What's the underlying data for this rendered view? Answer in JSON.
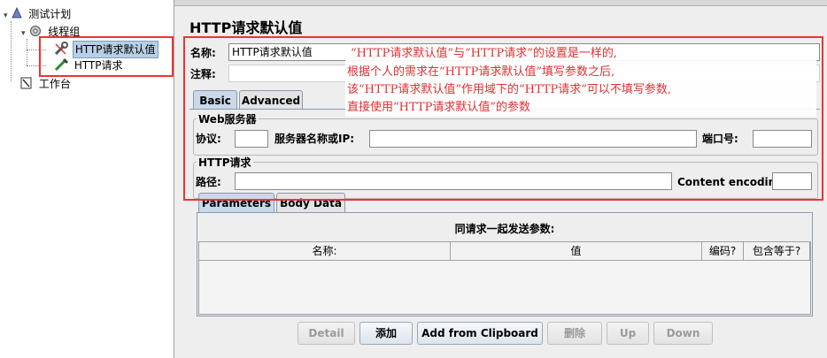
{
  "tree": {
    "test_plan": "测试计划",
    "thread_group": "线程组",
    "http_defaults": "HTTP请求默认值",
    "http_request": "HTTP请求",
    "workbench": "工作台"
  },
  "panel": {
    "title": "HTTP请求默认值",
    "name_label": "名称:",
    "name_value": "HTTP请求默认值",
    "comment_label": "注释:",
    "tabs": [
      "Basic",
      "Advanced"
    ],
    "web_server": {
      "title": "Web服务器",
      "protocol_label": "协议:",
      "server_label": "服务器名称或IP:",
      "port_label": "端口号:"
    },
    "http_request": {
      "title": "HTTP请求",
      "path_label": "路径:",
      "encoding_label": "Content encoding:"
    },
    "param_tabs": [
      "Parameters",
      "Body Data"
    ],
    "params_title": "同请求一起发送参数:",
    "columns": [
      "名称:",
      "值",
      "编码?",
      "包含等于?"
    ],
    "buttons": [
      "Detail",
      "添加",
      "Add from Clipboard",
      "删除",
      "Up",
      "Down"
    ]
  },
  "annotation": [
    "“HTTP请求默认值”与“HTTP请求”的设置是一样的,",
    "根据个人的需求在“HTTP请求默认值”填写参数之后,",
    "该“HTTP请求默认值”作用域下的“HTTP请求”可以不填写参数,",
    "直接使用“HTTP请求默认值”的参数"
  ],
  "colors": {
    "annotation": "#e03030",
    "highlight_box": "#e33333",
    "selection": "#b8cfe5"
  }
}
